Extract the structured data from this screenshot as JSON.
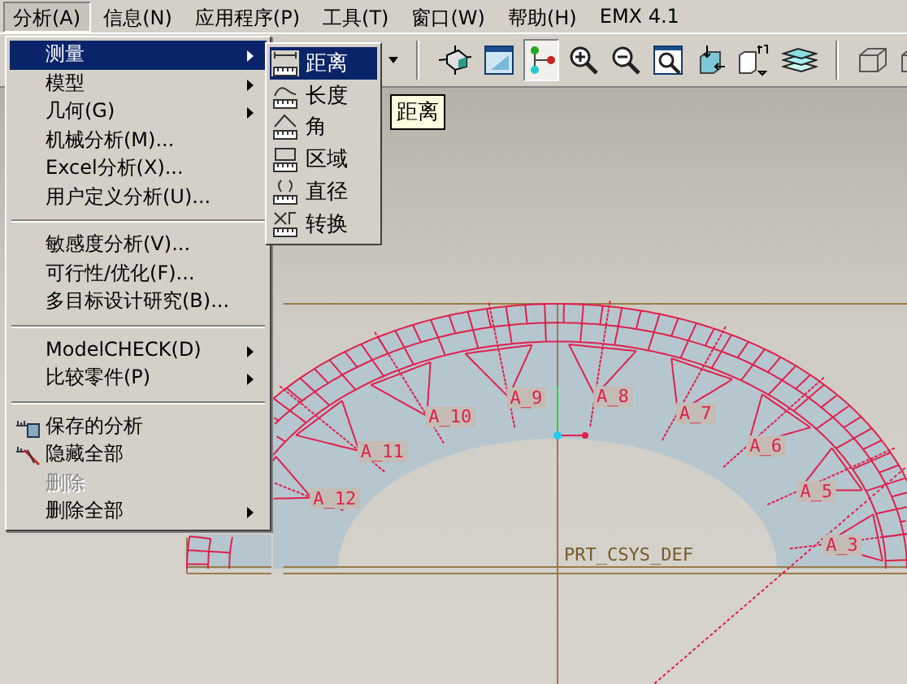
{
  "menubar": [
    {
      "label": "分析(A)",
      "selected": true
    },
    {
      "label": "信息(N)",
      "selected": false
    },
    {
      "label": "应用程序(P)",
      "selected": false
    },
    {
      "label": "工具(T)",
      "selected": false
    },
    {
      "label": "窗口(W)",
      "selected": false
    },
    {
      "label": "帮助(H)",
      "selected": false
    },
    {
      "label": "EMX 4.1",
      "selected": false
    }
  ],
  "toolbar": [
    {
      "kind": "dropdown"
    },
    {
      "kind": "sep"
    },
    {
      "kind": "spin",
      "on": false
    },
    {
      "kind": "display",
      "on": false
    },
    {
      "kind": "datums",
      "on": true
    },
    {
      "kind": "zoomin",
      "on": false
    },
    {
      "kind": "zoomout",
      "on": false
    },
    {
      "kind": "refit",
      "on": false
    },
    {
      "kind": "orient",
      "on": false
    },
    {
      "kind": "views",
      "on": false
    },
    {
      "kind": "layers",
      "on": false
    },
    {
      "kind": "sep"
    },
    {
      "kind": "cube",
      "on": false
    },
    {
      "kind": "cube",
      "on": false
    }
  ],
  "analysis_menu": [
    {
      "kind": "item",
      "label": "测量",
      "submenu": true,
      "selected": true,
      "disabled": false
    },
    {
      "kind": "item",
      "label": "模型",
      "submenu": true,
      "selected": false,
      "disabled": false
    },
    {
      "kind": "item",
      "label": "几何(G)",
      "submenu": true,
      "selected": false,
      "disabled": false
    },
    {
      "kind": "item",
      "label": "机械分析(M)...",
      "submenu": false,
      "selected": false,
      "disabled": false
    },
    {
      "kind": "item",
      "label": "Excel分析(X)...",
      "submenu": false,
      "selected": false,
      "disabled": false
    },
    {
      "kind": "item",
      "label": "用户定义分析(U)...",
      "submenu": false,
      "selected": false,
      "disabled": false
    },
    {
      "kind": "separator"
    },
    {
      "kind": "item",
      "label": "敏感度分析(V)...",
      "submenu": false,
      "selected": false,
      "disabled": false
    },
    {
      "kind": "item",
      "label": "可行性/优化(F)...",
      "submenu": false,
      "selected": false,
      "disabled": false
    },
    {
      "kind": "item",
      "label": "多目标设计研究(B)...",
      "submenu": false,
      "selected": false,
      "disabled": false
    },
    {
      "kind": "separator"
    },
    {
      "kind": "item",
      "label": "ModelCHECK(D)",
      "submenu": true,
      "selected": false,
      "disabled": false
    },
    {
      "kind": "item",
      "label": "比较零件(P)",
      "submenu": true,
      "selected": false,
      "disabled": false
    },
    {
      "kind": "separator"
    },
    {
      "kind": "saved",
      "label": "保存的分析",
      "submenu": false,
      "selected": false,
      "disabled": false
    },
    {
      "kind": "hide",
      "label": "隐藏全部",
      "submenu": false,
      "selected": false,
      "disabled": false
    },
    {
      "kind": "item",
      "label": "删除",
      "submenu": false,
      "selected": false,
      "disabled": true
    },
    {
      "kind": "item",
      "label": "删除全部",
      "submenu": true,
      "selected": false,
      "disabled": false
    }
  ],
  "measure_submenu": [
    {
      "kind": "distance",
      "label": "距离",
      "selected": true
    },
    {
      "kind": "length",
      "label": "长度",
      "selected": false
    },
    {
      "kind": "angle",
      "label": "角",
      "selected": false
    },
    {
      "kind": "area",
      "label": "区域",
      "selected": false
    },
    {
      "kind": "diameter",
      "label": "直径",
      "selected": false
    },
    {
      "kind": "transform",
      "label": "转换",
      "selected": false
    }
  ],
  "tooltip": "距离",
  "model": {
    "dimension_labels": [
      "A_12",
      "A_11",
      "A_10",
      "A_9",
      "A_8",
      "A_7",
      "A_6",
      "A_5",
      "A_3"
    ],
    "csys_label": "PRT_CSYS_DEF"
  }
}
